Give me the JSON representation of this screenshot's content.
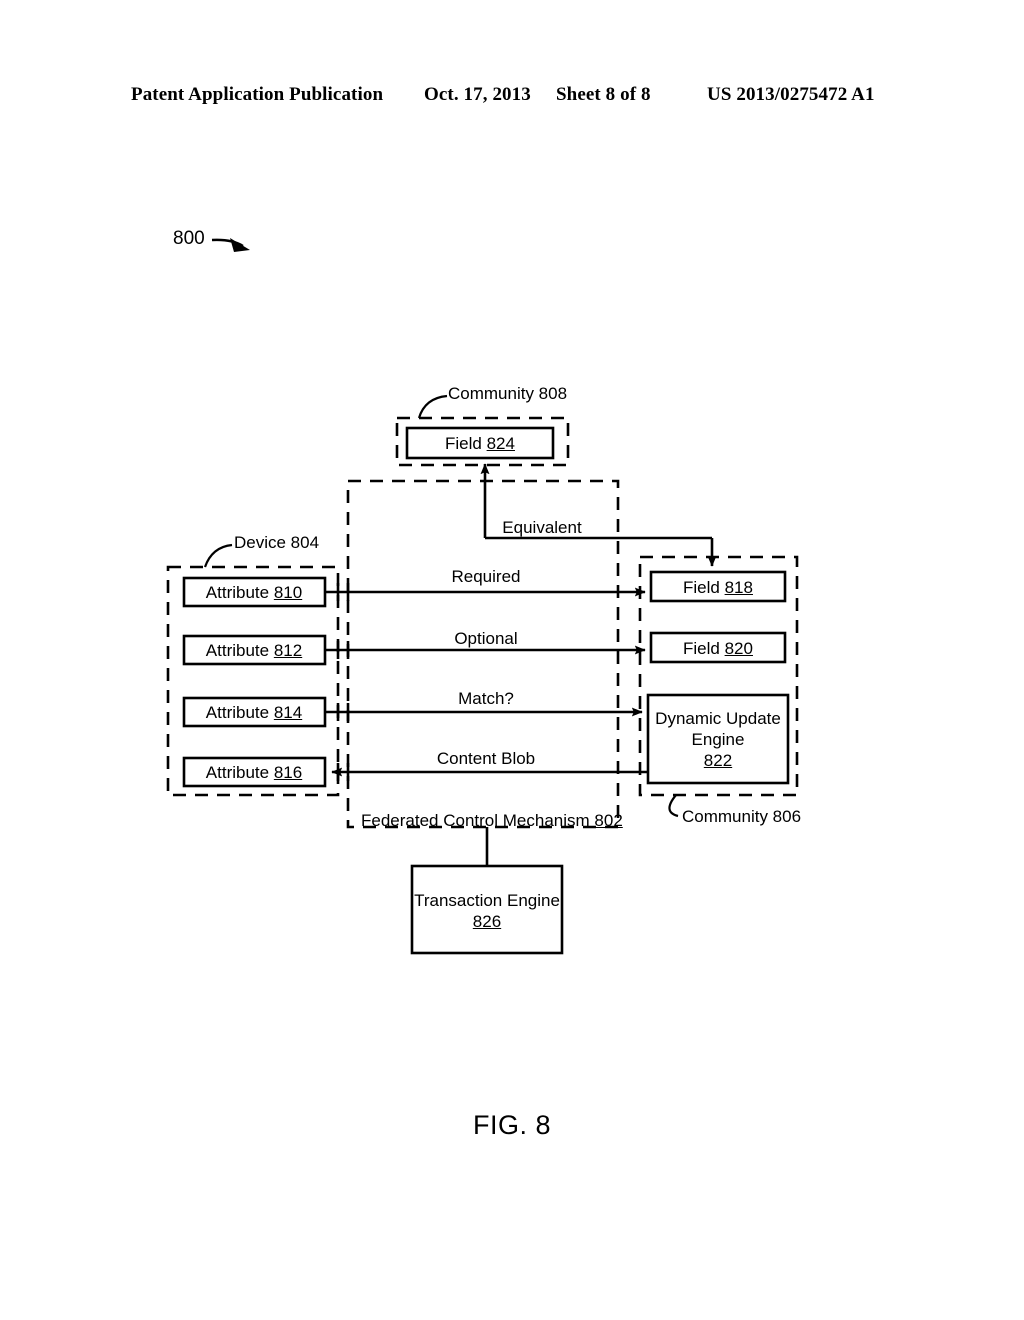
{
  "header": {
    "publication": "Patent Application Publication",
    "date": "Oct. 17, 2013",
    "sheet": "Sheet 8 of 8",
    "patent_number": "US 2013/0275472 A1"
  },
  "figure": {
    "caption": "FIG. 8",
    "reference_numeral": "800",
    "containers": [
      {
        "id": "community-808",
        "label_prefix": "Community",
        "label_number": "808",
        "label": "Community 808",
        "style": "dashed"
      },
      {
        "id": "device-804",
        "label_prefix": "Device",
        "label_number": "804",
        "label": "Device 804",
        "style": "dashed"
      },
      {
        "id": "community-806",
        "label_prefix": "Community",
        "label_number": "806",
        "label": "Community 806",
        "style": "dashed"
      },
      {
        "id": "federated-control-mechanism-802",
        "label_prefix": "Federated Control Mechanism",
        "label_number": "802",
        "label": "Federated Control Mechanism 802",
        "style": "dashed"
      }
    ],
    "boxes": [
      {
        "id": "field-824",
        "prefix": "Field ",
        "number": "824",
        "parent": "community-808"
      },
      {
        "id": "attribute-810",
        "prefix": "Attribute ",
        "number": "810",
        "parent": "device-804"
      },
      {
        "id": "attribute-812",
        "prefix": "Attribute ",
        "number": "812",
        "parent": "device-804"
      },
      {
        "id": "attribute-814",
        "prefix": "Attribute ",
        "number": "814",
        "parent": "device-804"
      },
      {
        "id": "attribute-816",
        "prefix": "Attribute ",
        "number": "816",
        "parent": "device-804"
      },
      {
        "id": "field-818",
        "prefix": "Field ",
        "number": "818",
        "parent": "community-806"
      },
      {
        "id": "field-820",
        "prefix": "Field ",
        "number": "820",
        "parent": "community-806"
      },
      {
        "id": "dynamic-update-engine-822",
        "line1": "Dynamic Update",
        "line2": "Engine",
        "number": "822",
        "parent": "community-806"
      },
      {
        "id": "transaction-engine-826",
        "line1": "Transaction Engine",
        "number": "826",
        "parent": "none"
      }
    ],
    "connector_labels": [
      {
        "id": "equivalent",
        "text": "Equivalent",
        "from": "field-818",
        "to": "field-824"
      },
      {
        "id": "required",
        "text": "Required",
        "from": "attribute-810",
        "to": "field-818"
      },
      {
        "id": "optional",
        "text": "Optional",
        "from": "attribute-812",
        "to": "field-820"
      },
      {
        "id": "match",
        "text": "Match?",
        "from": "attribute-814",
        "to": "dynamic-update-engine-822"
      },
      {
        "id": "content-blob",
        "text": "Content Blob",
        "from": "dynamic-update-engine-822",
        "to": "attribute-816"
      }
    ]
  }
}
